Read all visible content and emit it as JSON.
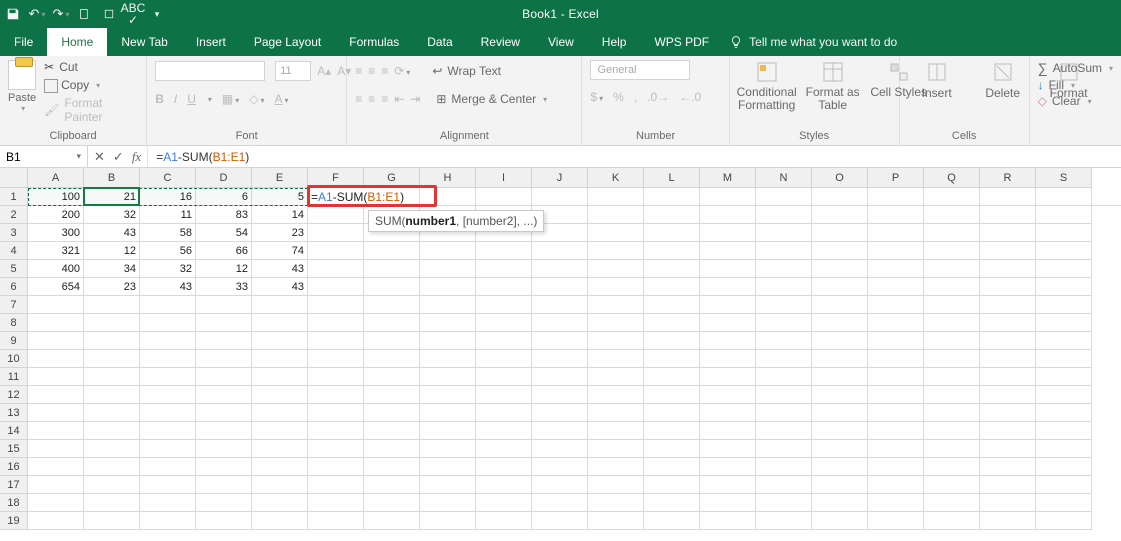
{
  "title": "Book1 - Excel",
  "qat": [
    "save",
    "undo",
    "redo",
    "new",
    "touch",
    "spellcheck",
    "customize"
  ],
  "menu": {
    "file": "File",
    "home": "Home",
    "newtab": "New Tab",
    "insert": "Insert",
    "pagelayout": "Page Layout",
    "formulas": "Formulas",
    "data": "Data",
    "review": "Review",
    "view": "View",
    "help": "Help",
    "wpspdf": "WPS PDF",
    "tellme": "Tell me what you want to do"
  },
  "ribbon": {
    "clipboard": {
      "label": "Clipboard",
      "paste": "Paste",
      "cut": "Cut",
      "copy": "Copy",
      "painter": "Format Painter"
    },
    "font": {
      "label": "Font",
      "size": "11",
      "bold": "B",
      "italic": "I",
      "underline": "U"
    },
    "alignment": {
      "label": "Alignment",
      "wrap": "Wrap Text",
      "merge": "Merge & Center"
    },
    "number": {
      "label": "Number",
      "format": "General"
    },
    "styles": {
      "label": "Styles",
      "cond": "Conditional Formatting",
      "tbl": "Format as Table",
      "cell": "Cell Styles"
    },
    "cells": {
      "label": "Cells",
      "insert": "Insert",
      "delete": "Delete",
      "format": "Format"
    },
    "editing": {
      "autosum": "AutoSum",
      "fill": "Fill",
      "clear": "Clear"
    }
  },
  "namebox": "B1",
  "formula": {
    "prefix": "=",
    "a1": "A1",
    "mid": "-SUM(",
    "range": "B1:E1",
    "suffix": ")",
    "raw": "=A1-SUM(B1:E1)"
  },
  "tooltip": {
    "fn": "SUM",
    "arg1": "number1",
    "rest": ", [number2], ...)"
  },
  "columns": [
    "A",
    "B",
    "C",
    "D",
    "E",
    "F",
    "G",
    "H",
    "I",
    "J",
    "K",
    "L",
    "M",
    "N",
    "O",
    "P",
    "Q",
    "R",
    "S"
  ],
  "rowcount": 19,
  "data": [
    [
      "100",
      "21",
      "16",
      "6",
      "5",
      "=A1-SUM(B1:E1)"
    ],
    [
      "200",
      "32",
      "11",
      "83",
      "14",
      ""
    ],
    [
      "300",
      "43",
      "58",
      "54",
      "23",
      ""
    ],
    [
      "321",
      "12",
      "56",
      "66",
      "74",
      ""
    ],
    [
      "400",
      "34",
      "32",
      "12",
      "43",
      ""
    ],
    [
      "654",
      "23",
      "43",
      "33",
      "43",
      ""
    ]
  ]
}
